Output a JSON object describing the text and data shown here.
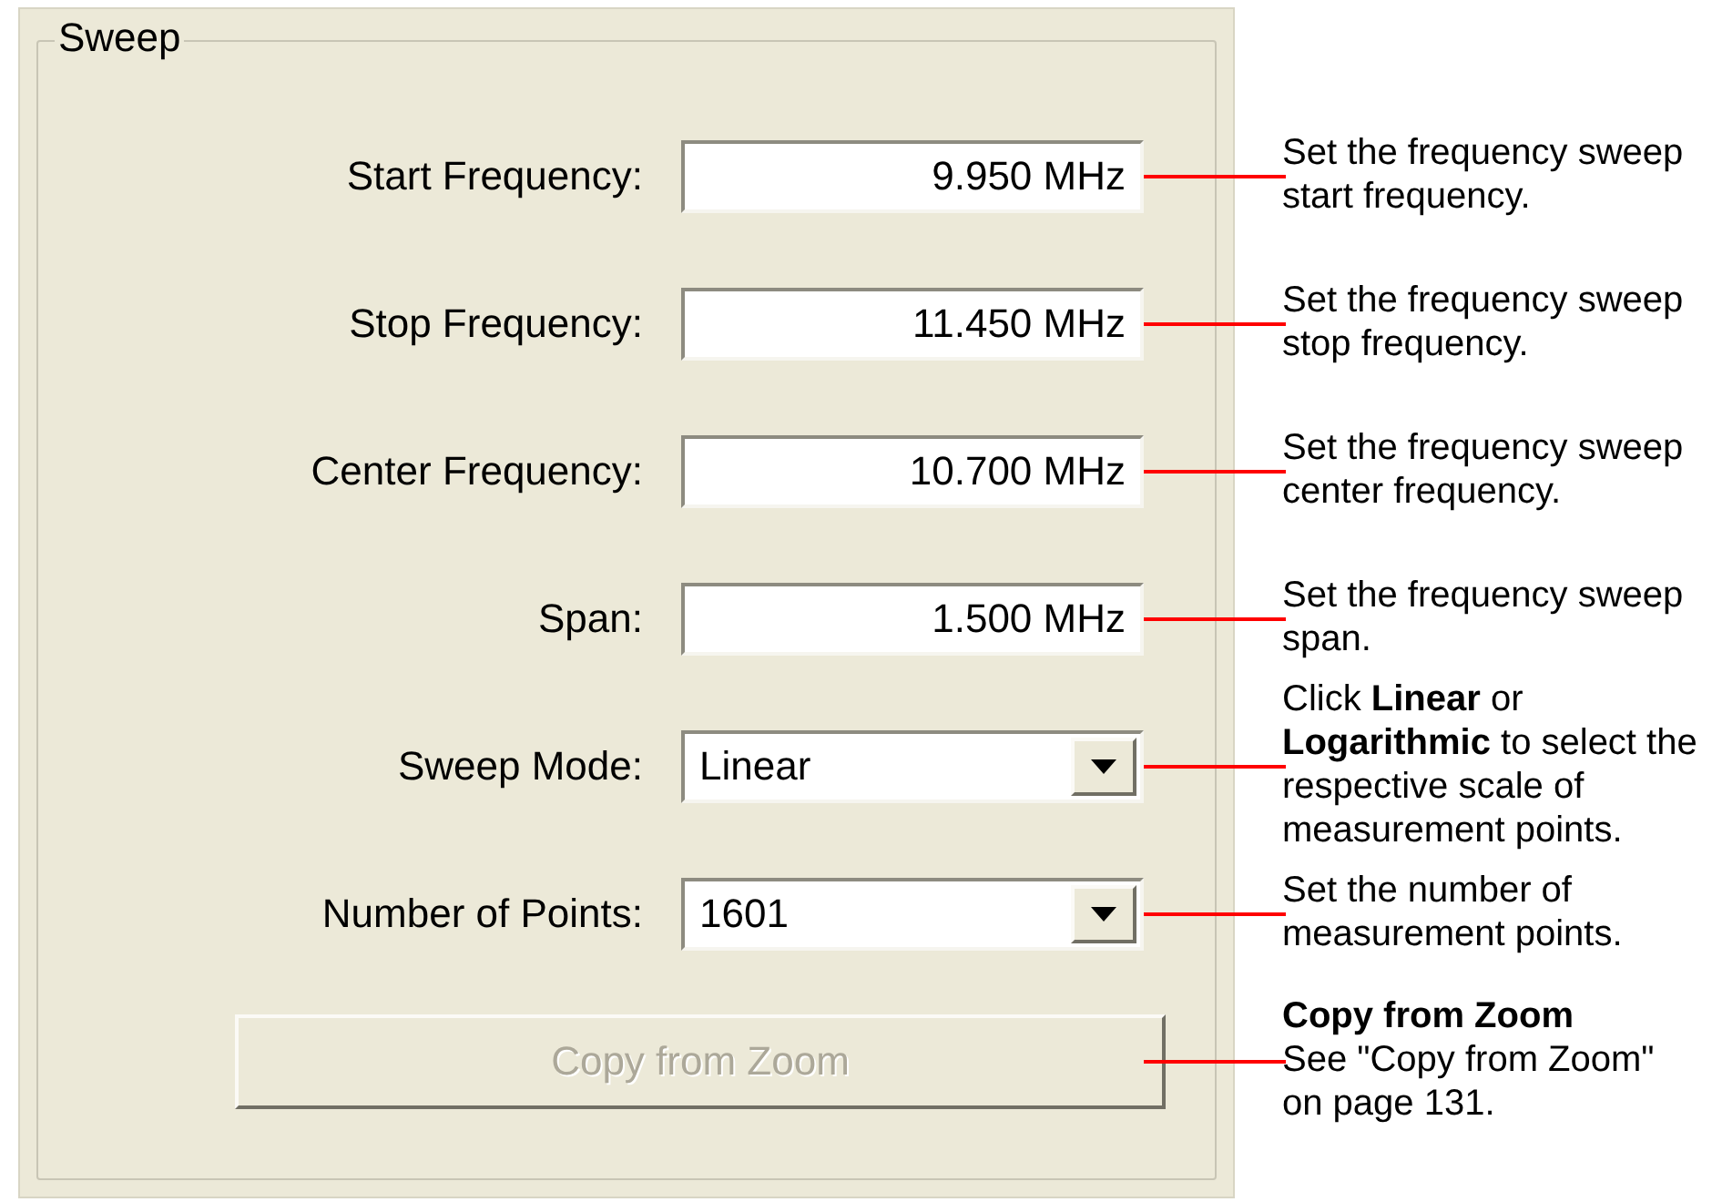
{
  "group": {
    "title": "Sweep"
  },
  "rows": [
    {
      "kind": "number",
      "label": "Start Frequency:",
      "value": "9.950 MHz",
      "note": "Set the frequency sweep start frequency."
    },
    {
      "kind": "number",
      "label": "Stop Frequency:",
      "value": "11.450 MHz",
      "note": "Set the frequency sweep stop frequency."
    },
    {
      "kind": "number",
      "label": "Center Frequency:",
      "value": "10.700 MHz",
      "note": "Set the frequency sweep center frequency."
    },
    {
      "kind": "number",
      "label": "Span:",
      "value": "1.500 MHz",
      "note": "Set the frequency sweep span."
    },
    {
      "kind": "dropdown",
      "label": "Sweep Mode:",
      "value": "Linear",
      "note": "Click **Linear** or **Logarithmic** to select the respective scale of measurement points."
    },
    {
      "kind": "dropdown",
      "label": "Number of Points:",
      "value": "1601",
      "note": "Set the number of measurement points."
    },
    {
      "kind": "button",
      "label": "Copy from Zoom",
      "disabled": true,
      "note_title": "Copy from Zoom",
      "note": "See  \"Copy from Zoom\" on page 131."
    }
  ]
}
